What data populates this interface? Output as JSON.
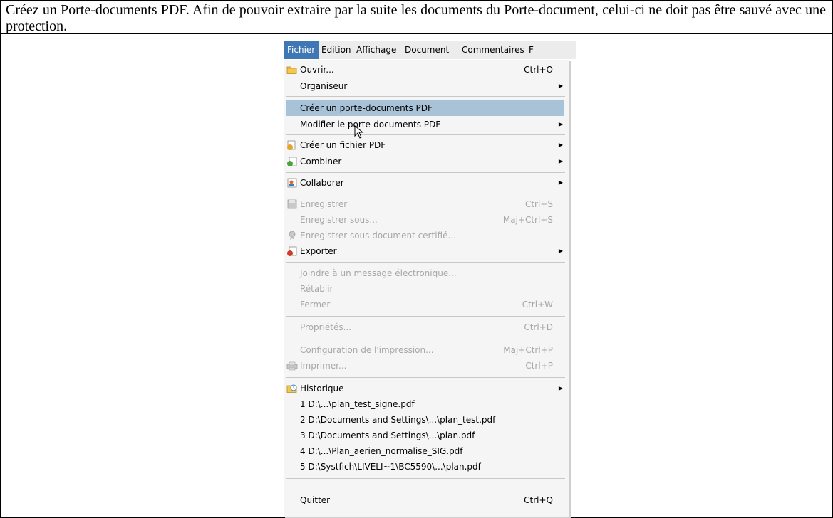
{
  "instruction": "Créez un Porte-documents PDF. Afin de pouvoir extraire par la suite les documents du Porte-document, celui-ci ne doit pas être sauvé avec une protection.",
  "menubar": {
    "items": [
      "Fichier",
      "Edition",
      "Affichage",
      "Document",
      "Commentaires",
      "F"
    ],
    "active": "Fichier"
  },
  "menu": {
    "open": {
      "label": "Ouvrir...",
      "shortcut": "Ctrl+O",
      "icon": "folder-icon"
    },
    "organizer": {
      "label": "Organiseur"
    },
    "create_portfolio": {
      "label": "Créer un porte-documents PDF"
    },
    "modify_portfolio": {
      "label": "Modifier le porte-documents PDF"
    },
    "create_pdf": {
      "label": "Créer un fichier PDF",
      "icon": "create-pdf-icon"
    },
    "combine": {
      "label": "Combiner",
      "icon": "combine-icon"
    },
    "collaborate": {
      "label": "Collaborer",
      "icon": "collaborate-icon"
    },
    "save": {
      "label": "Enregistrer",
      "shortcut": "Ctrl+S",
      "icon": "save-icon"
    },
    "save_as": {
      "label": "Enregistrer sous...",
      "shortcut": "Maj+Ctrl+S"
    },
    "save_certified": {
      "label": "Enregistrer sous document certifié...",
      "icon": "certified-icon"
    },
    "export": {
      "label": "Exporter",
      "icon": "export-icon"
    },
    "attach_email": {
      "label": "Joindre à un message électronique..."
    },
    "revert": {
      "label": "Rétablir"
    },
    "close": {
      "label": "Fermer",
      "shortcut": "Ctrl+W"
    },
    "properties": {
      "label": "Propriétés...",
      "shortcut": "Ctrl+D"
    },
    "print_setup": {
      "label": "Configuration de l'impression...",
      "shortcut": "Maj+Ctrl+P"
    },
    "print": {
      "label": "Imprimer...",
      "shortcut": "Ctrl+P",
      "icon": "printer-icon"
    },
    "history": {
      "label": "Historique",
      "icon": "history-icon"
    },
    "recent": [
      "1 D:\\...\\plan_test_signe.pdf",
      "2 D:\\Documents and Settings\\...\\plan_test.pdf",
      "3 D:\\Documents and Settings\\...\\plan.pdf",
      "4 D:\\...\\Plan_aerien_normalise_SIG.pdf",
      "5 D:\\Systfich\\LIVELI~1\\BC5590\\...\\plan.pdf"
    ],
    "quit": {
      "label": "Quitter",
      "shortcut": "Ctrl+Q"
    }
  },
  "colors": {
    "menu_background": "#f5f5f5",
    "menubar_active": "#3f77b5",
    "highlight": "#a8c2d8",
    "disabled_text": "#a7a7a7"
  }
}
